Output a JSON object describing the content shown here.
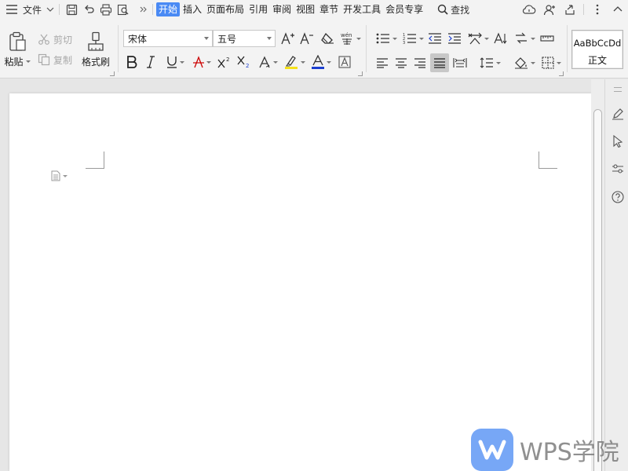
{
  "menubar": {
    "file_label": "文件",
    "tabs": [
      {
        "label": "开始",
        "active": true
      },
      {
        "label": "插入"
      },
      {
        "label": "页面布局"
      },
      {
        "label": "引用"
      },
      {
        "label": "审阅"
      },
      {
        "label": "视图"
      },
      {
        "label": "章节"
      },
      {
        "label": "开发工具"
      },
      {
        "label": "会员专享"
      }
    ],
    "search_label": "查找"
  },
  "ribbon": {
    "paste_label": "粘贴",
    "cut_label": "剪切",
    "copy_label": "复制",
    "format_painter_label": "格式刷",
    "font_name": "宋体",
    "font_size": "五号",
    "style_sample": "AaBbCcDd",
    "style_name": "正文"
  },
  "watermark": {
    "text": "WPS学院"
  },
  "colors": {
    "accent": "#4a8af4",
    "highlight": "#f5e11b",
    "font_color": "#1c3fcf"
  }
}
